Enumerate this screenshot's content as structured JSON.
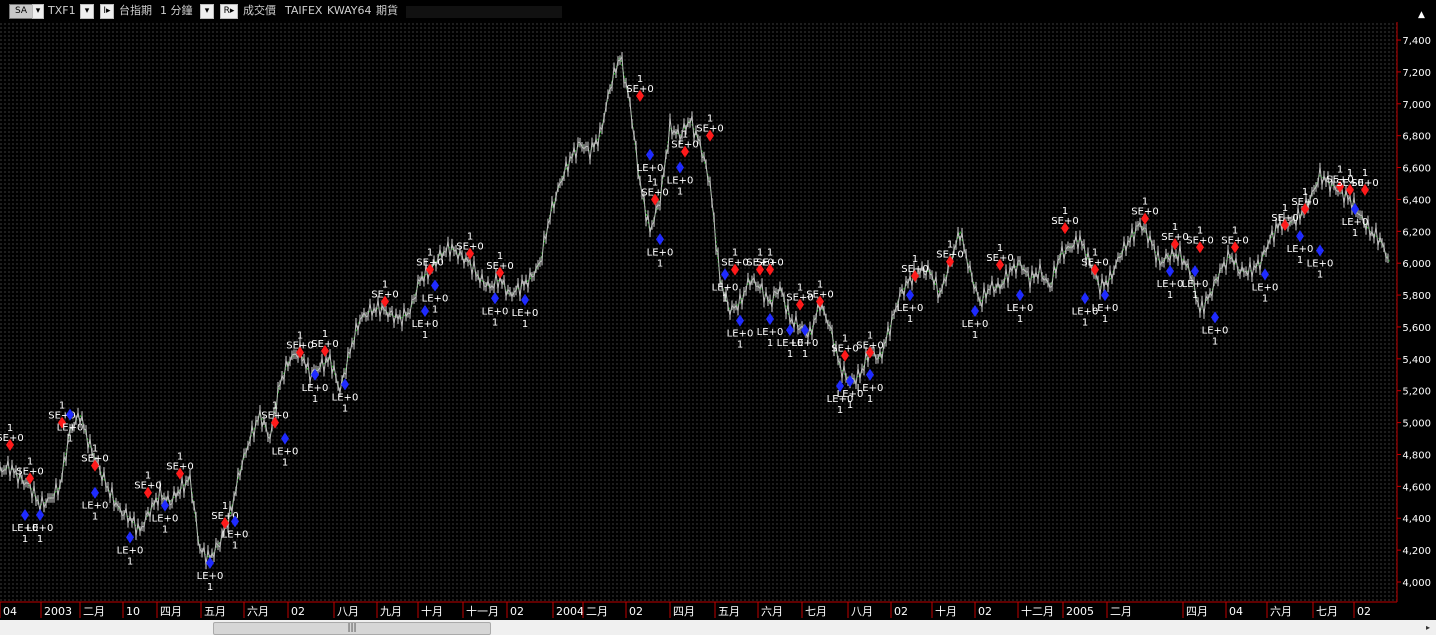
{
  "toolbar": {
    "sa_label": "SA",
    "symbol": "TXF1",
    "instrument": "台指期",
    "interval": "1 分鐘",
    "price_type": "成交價",
    "exchange": "TAIFEX",
    "strategy": "KWAY64",
    "market": "期貨"
  },
  "colors": {
    "background": "#000000",
    "grid": "#3a3a3a",
    "price": "#9a9a9a",
    "trail": "#21b321",
    "long_marker": "#1f2bff",
    "short_marker": "#ff1a1a",
    "axis_line": "#c00000",
    "text": "#ffffff"
  },
  "chart_data": {
    "type": "line",
    "title": "",
    "xlabel": "",
    "ylabel": "",
    "ylim": [
      3900,
      7500
    ],
    "y_ticks": [
      "4,000",
      "4,200",
      "4,400",
      "4,600",
      "4,800",
      "5,000",
      "5,200",
      "5,400",
      "5,600",
      "5,800",
      "6,000",
      "6,200",
      "6,400",
      "6,600",
      "6,800",
      "7,000",
      "7,200",
      "7,400"
    ],
    "x_ticks": [
      "04",
      "2003",
      "二月",
      "10",
      "四月",
      "五月",
      "六月",
      "02",
      "八月",
      "九月",
      "十月",
      "十一月",
      "02",
      "2004",
      "二月",
      "02",
      "四月",
      "五月",
      "六月",
      "七月",
      "八月",
      "02",
      "十月",
      "02",
      "十二月",
      "2005",
      "二月",
      "四月",
      "04",
      "六月",
      "七月",
      "02"
    ],
    "series": [
      {
        "x": [
          0,
          10,
          20,
          30,
          40,
          50,
          60,
          70,
          80,
          90,
          100,
          110,
          120,
          130,
          140,
          150,
          160,
          170,
          180,
          190,
          200,
          210,
          220,
          230,
          240,
          250,
          260,
          270,
          280,
          290,
          300,
          310,
          320,
          330,
          340,
          350,
          360,
          370,
          380,
          390,
          400,
          410,
          420,
          430,
          440,
          450,
          460,
          470,
          480,
          490,
          500,
          510,
          520,
          530,
          540,
          550,
          560,
          570,
          580,
          590,
          600,
          610,
          620,
          630,
          640,
          650,
          660,
          670,
          680,
          690,
          700,
          710,
          720,
          730,
          740,
          750,
          760,
          770,
          780,
          790,
          800,
          810,
          820,
          830,
          840,
          850,
          860,
          870,
          880,
          890,
          900,
          910,
          920,
          930,
          940,
          950,
          960,
          970,
          980,
          990,
          1000,
          1010,
          1020,
          1030,
          1040,
          1050,
          1060,
          1070,
          1080,
          1090,
          1100,
          1110,
          1120,
          1130,
          1140,
          1150,
          1160,
          1170,
          1180,
          1190,
          1200,
          1210,
          1220,
          1230,
          1240,
          1250,
          1260,
          1270,
          1280,
          1290,
          1300,
          1310,
          1320,
          1330,
          1340,
          1350,
          1360,
          1370,
          1380,
          1390
        ],
        "values": [
          4700,
          4720,
          4650,
          4600,
          4480,
          4520,
          4600,
          4950,
          5050,
          4850,
          4700,
          4560,
          4450,
          4400,
          4320,
          4450,
          4550,
          4500,
          4580,
          4650,
          4200,
          4150,
          4250,
          4420,
          4700,
          4900,
          5050,
          4900,
          5250,
          5400,
          5450,
          5300,
          5350,
          5400,
          5200,
          5450,
          5650,
          5700,
          5720,
          5680,
          5650,
          5700,
          5900,
          5950,
          6050,
          6100,
          6050,
          6000,
          5900,
          5850,
          5900,
          5800,
          5850,
          5900,
          6000,
          6300,
          6500,
          6650,
          6750,
          6700,
          6800,
          7100,
          7300,
          7000,
          6500,
          6200,
          6400,
          6850,
          6800,
          6900,
          6750,
          6500,
          5900,
          5700,
          5750,
          5900,
          5850,
          5750,
          5850,
          5650,
          5600,
          5550,
          5750,
          5600,
          5350,
          5250,
          5300,
          5450,
          5400,
          5600,
          5800,
          5900,
          5950,
          5950,
          5800,
          6000,
          6200,
          5950,
          5750,
          5850,
          5850,
          5950,
          6000,
          5900,
          5950,
          5850,
          6050,
          6100,
          6150,
          6000,
          5850,
          5900,
          6050,
          6150,
          6250,
          6150,
          6000,
          6050,
          6050,
          5950,
          5700,
          5800,
          5950,
          6050,
          5950,
          5950,
          6000,
          6150,
          6250,
          6250,
          6300,
          6400,
          6550,
          6500,
          6450,
          6400,
          6300,
          6200,
          6150,
          6000
        ]
      }
    ],
    "signals": {
      "labels": [
        "SE+0",
        "LE+0",
        "1"
      ],
      "short_entries": [
        {
          "x": 10,
          "y": 4860
        },
        {
          "x": 30,
          "y": 4650
        },
        {
          "x": 62,
          "y": 5000
        },
        {
          "x": 95,
          "y": 4730
        },
        {
          "x": 148,
          "y": 4560
        },
        {
          "x": 180,
          "y": 4680
        },
        {
          "x": 225,
          "y": 4370
        },
        {
          "x": 275,
          "y": 5000
        },
        {
          "x": 300,
          "y": 5440
        },
        {
          "x": 325,
          "y": 5450
        },
        {
          "x": 385,
          "y": 5760
        },
        {
          "x": 430,
          "y": 5960
        },
        {
          "x": 470,
          "y": 6060
        },
        {
          "x": 500,
          "y": 5940
        },
        {
          "x": 640,
          "y": 7050
        },
        {
          "x": 655,
          "y": 6400
        },
        {
          "x": 685,
          "y": 6700
        },
        {
          "x": 710,
          "y": 6800
        },
        {
          "x": 735,
          "y": 5960
        },
        {
          "x": 760,
          "y": 5960
        },
        {
          "x": 770,
          "y": 5960
        },
        {
          "x": 800,
          "y": 5740
        },
        {
          "x": 820,
          "y": 5760
        },
        {
          "x": 845,
          "y": 5420
        },
        {
          "x": 870,
          "y": 5440
        },
        {
          "x": 915,
          "y": 5920
        },
        {
          "x": 950,
          "y": 6010
        },
        {
          "x": 1000,
          "y": 5990
        },
        {
          "x": 1065,
          "y": 6220
        },
        {
          "x": 1095,
          "y": 5960
        },
        {
          "x": 1145,
          "y": 6280
        },
        {
          "x": 1175,
          "y": 6120
        },
        {
          "x": 1200,
          "y": 6100
        },
        {
          "x": 1235,
          "y": 6100
        },
        {
          "x": 1285,
          "y": 6240
        },
        {
          "x": 1305,
          "y": 6340
        },
        {
          "x": 1340,
          "y": 6480
        },
        {
          "x": 1350,
          "y": 6460
        },
        {
          "x": 1365,
          "y": 6460
        }
      ],
      "long_entries": [
        {
          "x": 25,
          "y": 4420
        },
        {
          "x": 40,
          "y": 4420
        },
        {
          "x": 70,
          "y": 5050
        },
        {
          "x": 95,
          "y": 4560
        },
        {
          "x": 130,
          "y": 4280
        },
        {
          "x": 165,
          "y": 4480
        },
        {
          "x": 210,
          "y": 4120
        },
        {
          "x": 235,
          "y": 4380
        },
        {
          "x": 285,
          "y": 4900
        },
        {
          "x": 315,
          "y": 5300
        },
        {
          "x": 345,
          "y": 5240
        },
        {
          "x": 425,
          "y": 5700
        },
        {
          "x": 435,
          "y": 5860
        },
        {
          "x": 495,
          "y": 5780
        },
        {
          "x": 525,
          "y": 5770
        },
        {
          "x": 650,
          "y": 6680
        },
        {
          "x": 660,
          "y": 6150
        },
        {
          "x": 680,
          "y": 6600
        },
        {
          "x": 725,
          "y": 5930
        },
        {
          "x": 740,
          "y": 5640
        },
        {
          "x": 770,
          "y": 5650
        },
        {
          "x": 790,
          "y": 5580
        },
        {
          "x": 805,
          "y": 5580
        },
        {
          "x": 840,
          "y": 5230
        },
        {
          "x": 850,
          "y": 5260
        },
        {
          "x": 870,
          "y": 5300
        },
        {
          "x": 910,
          "y": 5800
        },
        {
          "x": 975,
          "y": 5700
        },
        {
          "x": 1020,
          "y": 5800
        },
        {
          "x": 1085,
          "y": 5780
        },
        {
          "x": 1105,
          "y": 5800
        },
        {
          "x": 1170,
          "y": 5950
        },
        {
          "x": 1195,
          "y": 5950
        },
        {
          "x": 1215,
          "y": 5660
        },
        {
          "x": 1265,
          "y": 5930
        },
        {
          "x": 1300,
          "y": 6170
        },
        {
          "x": 1320,
          "y": 6080
        },
        {
          "x": 1355,
          "y": 6340
        }
      ]
    }
  }
}
